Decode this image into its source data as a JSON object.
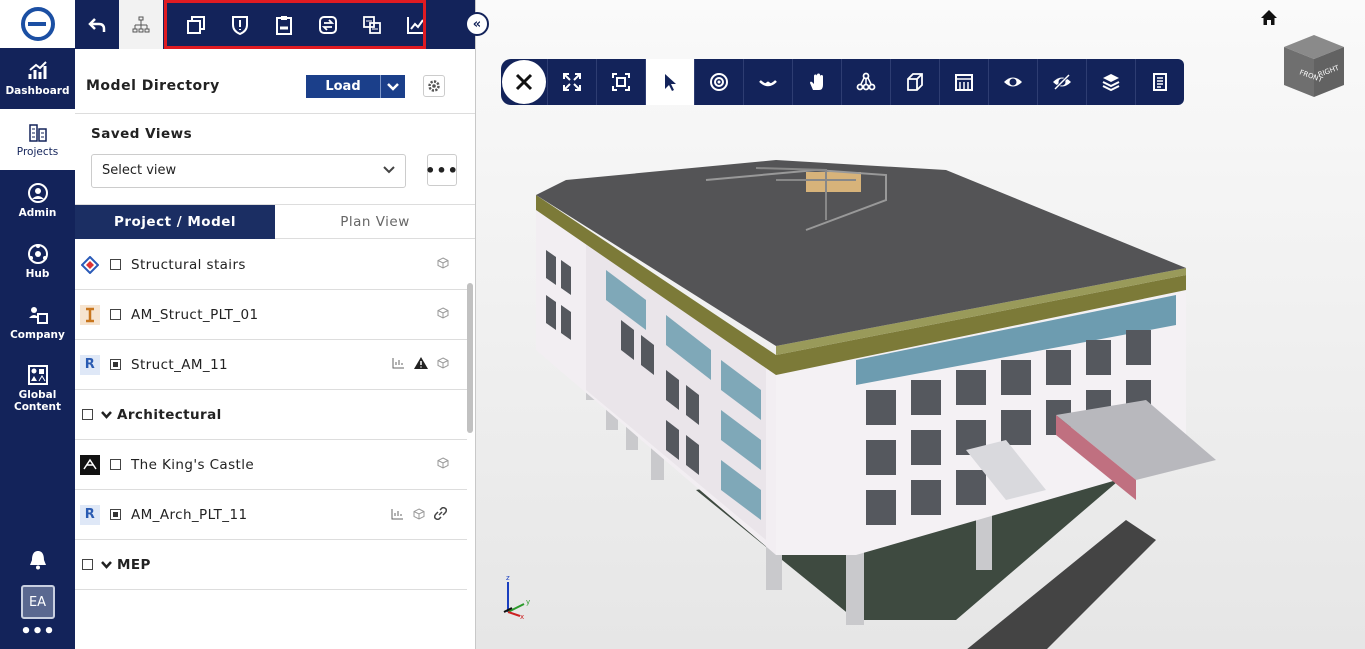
{
  "rail": {
    "items": [
      {
        "label": "Dashboard",
        "icon": "chart-icon",
        "active": false
      },
      {
        "label": "Projects",
        "icon": "buildings-icon",
        "active": true
      },
      {
        "label": "Admin",
        "icon": "user-circle-icon",
        "active": false
      },
      {
        "label": "Hub",
        "icon": "hub-icon",
        "active": false
      },
      {
        "label": "Company",
        "icon": "company-icon",
        "active": false
      },
      {
        "label": "Global Content",
        "icon": "global-content-icon",
        "active": false
      }
    ],
    "avatar": "EA",
    "more": "•••"
  },
  "panel": {
    "title": "Model Directory",
    "load_label": "Load",
    "saved_views_title": "Saved Views",
    "saved_views_placeholder": "Select view",
    "more_label": "•••",
    "tabs": [
      "Project / Model",
      "Plan View"
    ],
    "items": [
      {
        "label": "Structural stairs",
        "type": "model",
        "source": "mixed-icon",
        "checkbox": "empty"
      },
      {
        "label": "AM_Struct_PLT_01",
        "type": "model",
        "source": "ifc-icon",
        "checkbox": "empty"
      },
      {
        "label": "Struct_AM_11",
        "type": "model",
        "source": "revit-icon",
        "checkbox": "filled",
        "warning": true
      },
      {
        "label": "Architectural",
        "type": "group"
      },
      {
        "label": "The King's Castle",
        "type": "model",
        "source": "sketch-icon",
        "checkbox": "empty"
      },
      {
        "label": "AM_Arch_PLT_11",
        "type": "model",
        "source": "revit-icon",
        "checkbox": "filled",
        "link": true
      },
      {
        "label": "MEP",
        "type": "group"
      }
    ]
  },
  "viewer": {
    "cube_faces": [
      "FRONT",
      "RIGHT"
    ],
    "axis_labels": [
      "z",
      "y",
      "x"
    ]
  },
  "colors": {
    "navy": "#13235a",
    "accent": "#1b3f8a",
    "highlight": "#e01b22"
  }
}
